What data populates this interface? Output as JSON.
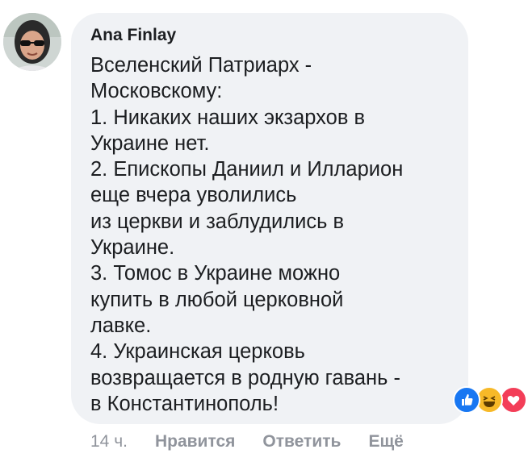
{
  "comment": {
    "author": "Ana Finlay",
    "text": "Вселенский Патриарх -\nМосковскому:\n1. Никаких наших экзархов в\nУкраине нет.\n2. Епископы Даниил и Илларион\nеще вчера уволились\nиз церкви и заблудились в\nУкраине.\n3. Томос в Украине можно\nкупить в любой церковной\nлавке.\n4. Украинская церковь\nвозвращается в родную гавань -\nв Константинополь!",
    "reactions": [
      "like-icon",
      "haha-icon",
      "love-icon"
    ]
  },
  "actions": {
    "time": "14 ч.",
    "like_label": "Нравится",
    "reply_label": "Ответить",
    "more_label": "Ещё"
  },
  "colors": {
    "bubble_bg": "#f0f2f5",
    "text": "#1c1e21",
    "meta": "#90949c",
    "like_blue": "#1877f2",
    "haha_yellow": "#f7b928",
    "love_red": "#f33e58"
  }
}
